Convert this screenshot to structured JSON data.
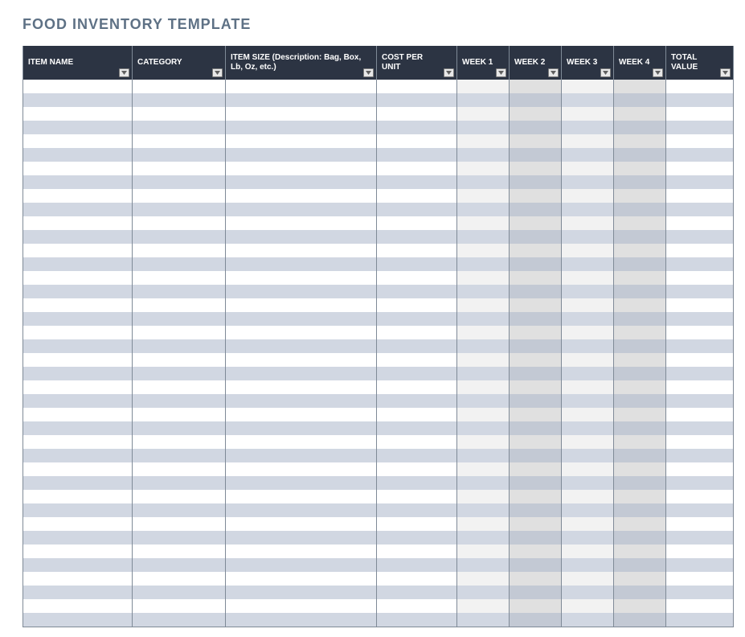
{
  "title": "FOOD INVENTORY  TEMPLATE",
  "columns": {
    "item_name": "ITEM NAME",
    "category": "CATEGORY",
    "item_size": "ITEM SIZE (Description: Bag, Box, Lb, Oz, etc.)",
    "cost_per_unit": "COST PER UNIT",
    "week1": "WEEK 1",
    "week2": "WEEK 2",
    "week3": "WEEK 3",
    "week4": "WEEK 4",
    "total_value": "TOTAL VALUE"
  },
  "row_count": 40,
  "rows": []
}
